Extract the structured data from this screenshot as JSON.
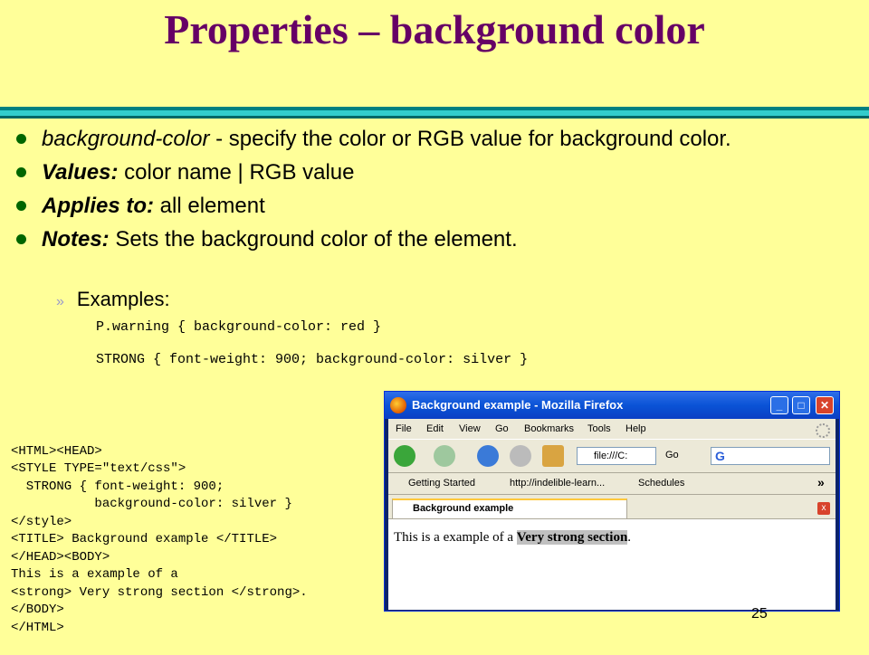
{
  "slide": {
    "title": "Properties – background color",
    "bullets": [
      {
        "term": "background-color",
        "text": " - specify the color or RGB value for background color."
      },
      {
        "term": "Values:",
        "text": " color name | RGB value"
      },
      {
        "term": "Applies to:",
        "text": " all element"
      },
      {
        "term": "Notes:",
        "text": " Sets the background color of the element."
      }
    ],
    "sub_char": "»",
    "sub_label": "Examples:",
    "code_example_1": "P.warning { background-color: red }",
    "code_example_2": "STRONG { font-weight: 900; background-color: silver }",
    "left_code": [
      "<HTML><HEAD>",
      "<STYLE TYPE=\"text/css\">",
      "  STRONG { font-weight: 900;",
      "           background-color: silver }",
      "</style>",
      "<TITLE> Background example </TITLE>",
      "</HEAD><BODY>",
      "This is a example of a",
      "<strong> Very strong section </strong>.",
      "</BODY>",
      "</HTML>"
    ],
    "page_number": "25"
  },
  "colors": {
    "background": "#ffff99",
    "title": "#660066",
    "bullet": "#006600"
  },
  "browser": {
    "title": "Background example - Mozilla Firefox",
    "minimize": "_",
    "maximize": "□",
    "close": "✕",
    "menu": [
      "File",
      "Edit",
      "View",
      "Go",
      "Bookmarks",
      "Tools",
      "Help"
    ],
    "url": "file:///C:",
    "go_label": "Go",
    "search_logo": "G",
    "bookmarks": [
      "Getting Started",
      "http://indelible-learn...",
      "Schedules"
    ],
    "bookmarks_more": "»",
    "tab_label": "Background example",
    "content_prefix": "This is a example of a ",
    "content_strong": "Very strong section",
    "content_suffix": "."
  }
}
